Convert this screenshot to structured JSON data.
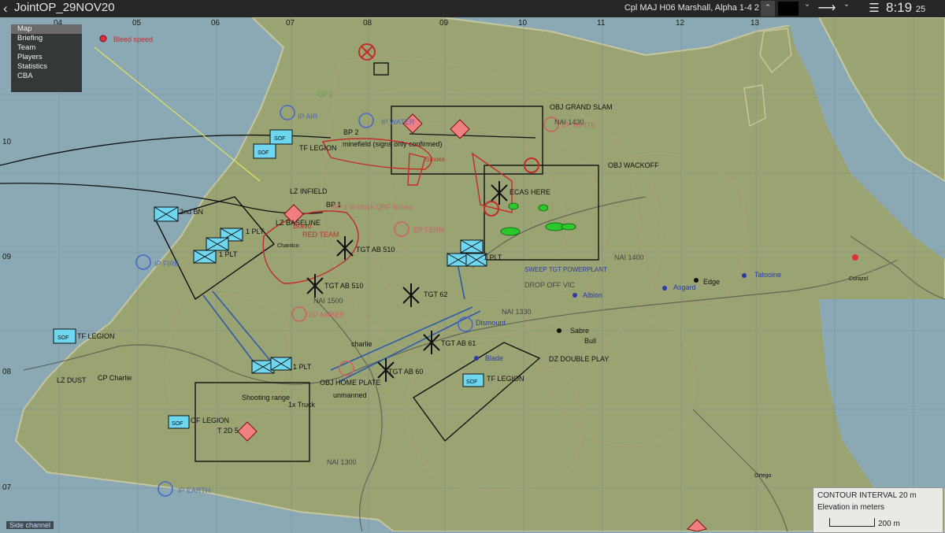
{
  "window": {
    "back_icon": "chevron-left-icon",
    "title": "JointOP_29NOV20",
    "player": "Cpl MAJ H06 Marshall, Alpha 1-4 2"
  },
  "clock": {
    "hm": "8:19",
    "sec": "25"
  },
  "menu": {
    "items": [
      {
        "label": "Map",
        "active": true
      },
      {
        "label": "Briefing"
      },
      {
        "label": "Team"
      },
      {
        "label": "Players"
      },
      {
        "label": "Statistics"
      },
      {
        "label": "CBA"
      }
    ]
  },
  "chat": {
    "channel": "Side channel"
  },
  "legend": {
    "title": "CONTOUR INTERVAL 20 m",
    "subtitle": "Elevation in meters",
    "scale": "200 m"
  },
  "grid": {
    "top": [
      "04",
      "05",
      "06",
      "07",
      "08",
      "09",
      "10",
      "11",
      "12",
      "13"
    ],
    "left": [
      "10",
      "09",
      "08",
      "07"
    ]
  },
  "colors": {
    "sea": "#8aa9b4",
    "land": "#9aa473",
    "friendly": "#6fd6f0",
    "enemy": "#e0303b",
    "objective": "#111111",
    "topbar": "#262626"
  },
  "labels": {
    "bleed": "Bleed speed",
    "cp2": "CP 2",
    "ip_air": "IP AIR",
    "ip_water": "IP WATER",
    "ip_fire": "IP FIRE",
    "ip_earth": "IP EARTH",
    "ep_white": "EP WHITE",
    "ep_fern": "EP FERN",
    "ep_amber": "EP AMBER",
    "obj_grand": "OBJ GRAND SLAM",
    "obj_wack": "OBJ WACKOFF",
    "tgt_ab510a": "TGT AB 510",
    "tgt_ab510b": "TGT AB 510",
    "tgt_ab62": "TGT 62",
    "tgt_ab61": "TGT AB 61",
    "tgt_ab60": "TGT AB 60",
    "lz_infield": "LZ INFIELD",
    "lz_baseline": "LZ BASELINE",
    "bp1": "BP 1",
    "bp2": "BP 2",
    "tf1": "TF LEGION",
    "tf2": "TF LEGION",
    "tf3": "TF LEGION",
    "tf4": "OF LEGION",
    "bn2": "2nd BN",
    "plt1": "1 PLT",
    "plt2": "1 PLT",
    "plt3": "1 PLT",
    "plt4": "1 PLT",
    "cp_charlie": "CP Charlie",
    "charlie": "charlie",
    "dz": "DZ DOUBLE PLAY",
    "blade": "Blade",
    "sabre": "Sabre",
    "bull": "Bull",
    "albion": "Albion",
    "asgard": "Asgard",
    "tatooine": "Tatooine",
    "edge": "Edge",
    "dismount": "Dismount",
    "obj_home": "OBJ HOME PLATE",
    "truck": "1x Truck",
    "unmanned": "unmanned",
    "shooting": "Shooting range",
    "minefield": "minefield (signs only confirmed)",
    "ecas": "ECAS HERE",
    "drop_off": "DROP OFF VIC",
    "red_team": "RED TEAM",
    "bravo": "Bravo",
    "block_orf": "BP 1 to block QRF forces",
    "nai1430": "NAI 1430",
    "nai1400": "NAI 1400",
    "nai1500": "NAI 1500",
    "nai1330": "NAI 1330",
    "nai1300": "NAI 1300",
    "city_corazol": "Corazol",
    "city_chantico": "Chantico",
    "city_ortego": "Ortego",
    "sweep": "SWEEP TGT POWERPLANT",
    "lz_dust": "LZ DUST",
    "smoke": "Smoke",
    "t2d5": "T 2D 5"
  }
}
